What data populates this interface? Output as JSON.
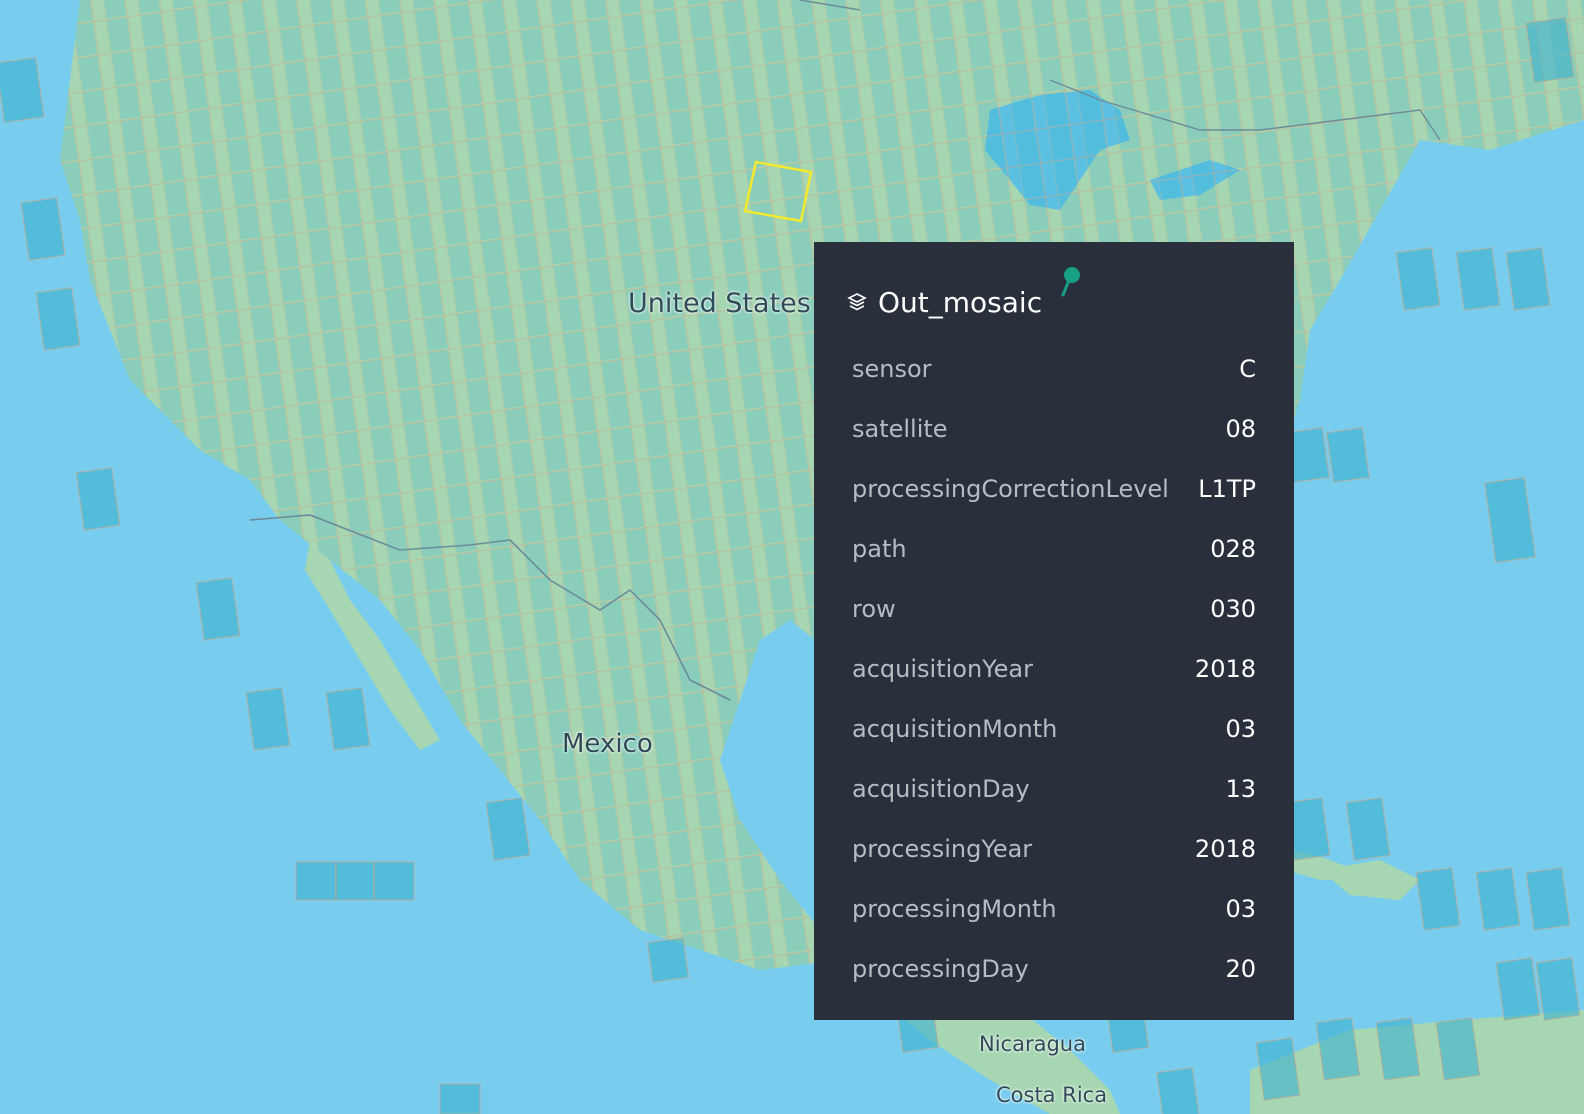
{
  "map": {
    "labels": {
      "united_states": "United States",
      "mexico": "Mexico",
      "nicaragua": "Nicaragua",
      "costa_rica": "Costa Rica"
    },
    "colors": {
      "water": "#78cdee",
      "land": "#a7d7b2",
      "tile_fill": "#3cb1cf",
      "highlight": "#f4ea2d"
    }
  },
  "tooltip": {
    "layer_icon": "layers-icon",
    "pin_icon": "pin-icon",
    "title": "Out_mosaic",
    "rows": [
      {
        "key": "sensor",
        "value": "C"
      },
      {
        "key": "satellite",
        "value": "08"
      },
      {
        "key": "processingCorrectionLevel",
        "value": "L1TP"
      },
      {
        "key": "path",
        "value": "028"
      },
      {
        "key": "row",
        "value": "030"
      },
      {
        "key": "acquisitionYear",
        "value": "2018"
      },
      {
        "key": "acquisitionMonth",
        "value": "03"
      },
      {
        "key": "acquisitionDay",
        "value": "13"
      },
      {
        "key": "processingYear",
        "value": "2018"
      },
      {
        "key": "processingMonth",
        "value": "03"
      },
      {
        "key": "processingDay",
        "value": "20"
      }
    ]
  }
}
